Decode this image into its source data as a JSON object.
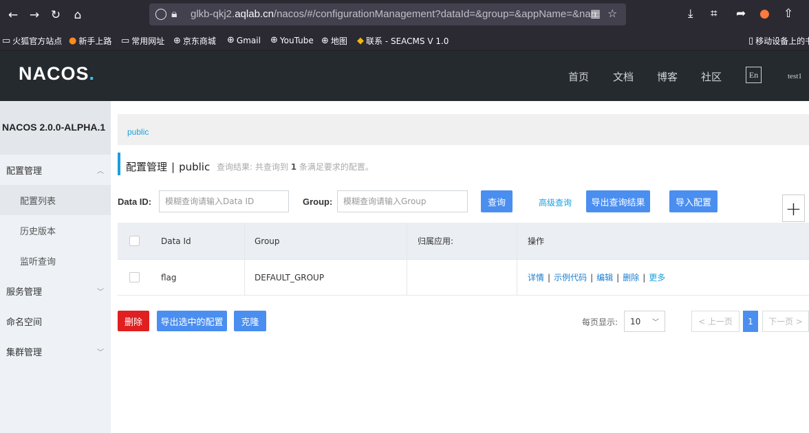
{
  "browser": {
    "url_prefix": "glkb-qkj2.",
    "url_domain": "aqlab.cn",
    "url_rest": "/nacos/#/configurationManagement?dataId=&group=&appName=&nan",
    "bookmarks": [
      {
        "label": "火狐官方站点",
        "icon": "folder-icon"
      },
      {
        "label": "新手上路",
        "icon": "firefox-icon"
      },
      {
        "label": "常用网址",
        "icon": "folder-icon"
      },
      {
        "label": "京东商城",
        "icon": "globe-icon"
      },
      {
        "label": "Gmail",
        "icon": "globe-icon"
      },
      {
        "label": "YouTube",
        "icon": "globe-icon"
      },
      {
        "label": "地图",
        "icon": "globe-icon"
      },
      {
        "label": "联系 - SEACMS V 1.0",
        "icon": "seacms-icon"
      },
      {
        "label": "移动设备上的书",
        "icon": "mobile-icon"
      }
    ]
  },
  "header": {
    "logo": "NACOS",
    "nav": [
      "首页",
      "文档",
      "博客",
      "社区"
    ],
    "lang": "En",
    "user": "test1"
  },
  "sidebar": {
    "version": "NACOS 2.0.0-ALPHA.1",
    "items": [
      {
        "label": "配置管理"
      },
      {
        "label": "配置列表"
      },
      {
        "label": "历史版本"
      },
      {
        "label": "监听查询"
      },
      {
        "label": "服务管理"
      },
      {
        "label": "命名空间"
      },
      {
        "label": "集群管理"
      }
    ]
  },
  "main": {
    "breadcrumb": "public",
    "title": "配置管理",
    "namespace": "public",
    "result_prefix": "查询结果: 共查询到",
    "result_count": "1",
    "result_suffix": "条满足要求的配置。",
    "data_id_label": "Data ID:",
    "data_id_placeholder": "模糊查询请输入Data ID",
    "group_label": "Group:",
    "group_placeholder": "模糊查询请输入Group",
    "query_button": "查询",
    "advanced_query": "高级查询",
    "export_results_button": "导出查询结果",
    "import_button": "导入配置",
    "add_button": "+"
  },
  "table": {
    "columns": [
      "Data Id",
      "Group",
      "归属应用:",
      "操作"
    ],
    "rows": [
      {
        "data_id": "flag",
        "group": "DEFAULT_GROUP",
        "app": "",
        "ops": [
          "详情",
          "示例代码",
          "编辑",
          "删除",
          "更多"
        ]
      }
    ]
  },
  "footer": {
    "delete_button": "删除",
    "export_selected_button": "导出选中的配置",
    "clone_button": "克隆",
    "per_page_label": "每页显示:",
    "page_size": "10",
    "prev": "< 上一页",
    "current_page": "1",
    "next": "下一页 >"
  }
}
